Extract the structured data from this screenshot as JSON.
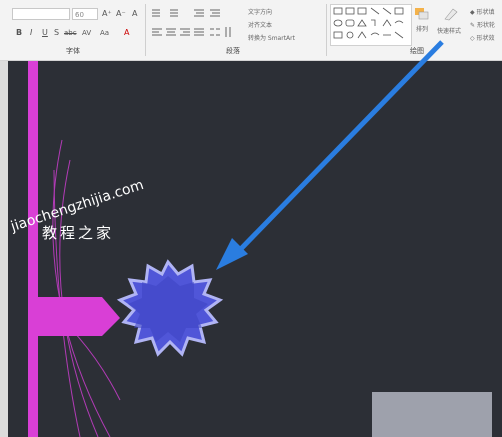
{
  "ribbon": {
    "font": {
      "font_name_value": "",
      "font_size_value": "60",
      "grow_font": "A⁺",
      "shrink_font": "A⁻",
      "clear_format": "A",
      "bold": "B",
      "italic": "I",
      "underline": "U",
      "shadow": "S",
      "strikethrough": "abc",
      "char_spacing": "AV",
      "change_case": "Aa",
      "font_color": "A",
      "group_label": "字体"
    },
    "paragraph": {
      "text_direction": "文字方向",
      "align_text": "对齐文本",
      "convert_smartart": "转换为 SmartArt",
      "group_label": "段落"
    },
    "drawing": {
      "arrange": "排列",
      "quick_styles": "快速样式",
      "shape_fill": "形状填",
      "shape_outline": "形状轮",
      "shape_effects": "形状效",
      "group_label": "绘图"
    }
  },
  "slide": {
    "watermark_domain": "jiaochengzhijia.com",
    "watermark_chinese": "教程之家"
  },
  "colors": {
    "slide_bg": "#2c2f36",
    "magenta": "#d93fd6",
    "arrow_blue": "#2a7de0",
    "star_fill": "#5056d8",
    "star_edge": "#9aa0f0"
  },
  "icons": [
    "shapes-gallery-icon",
    "arrange-icon",
    "quick-styles-icon",
    "fill-icon",
    "outline-icon",
    "effects-icon"
  ]
}
